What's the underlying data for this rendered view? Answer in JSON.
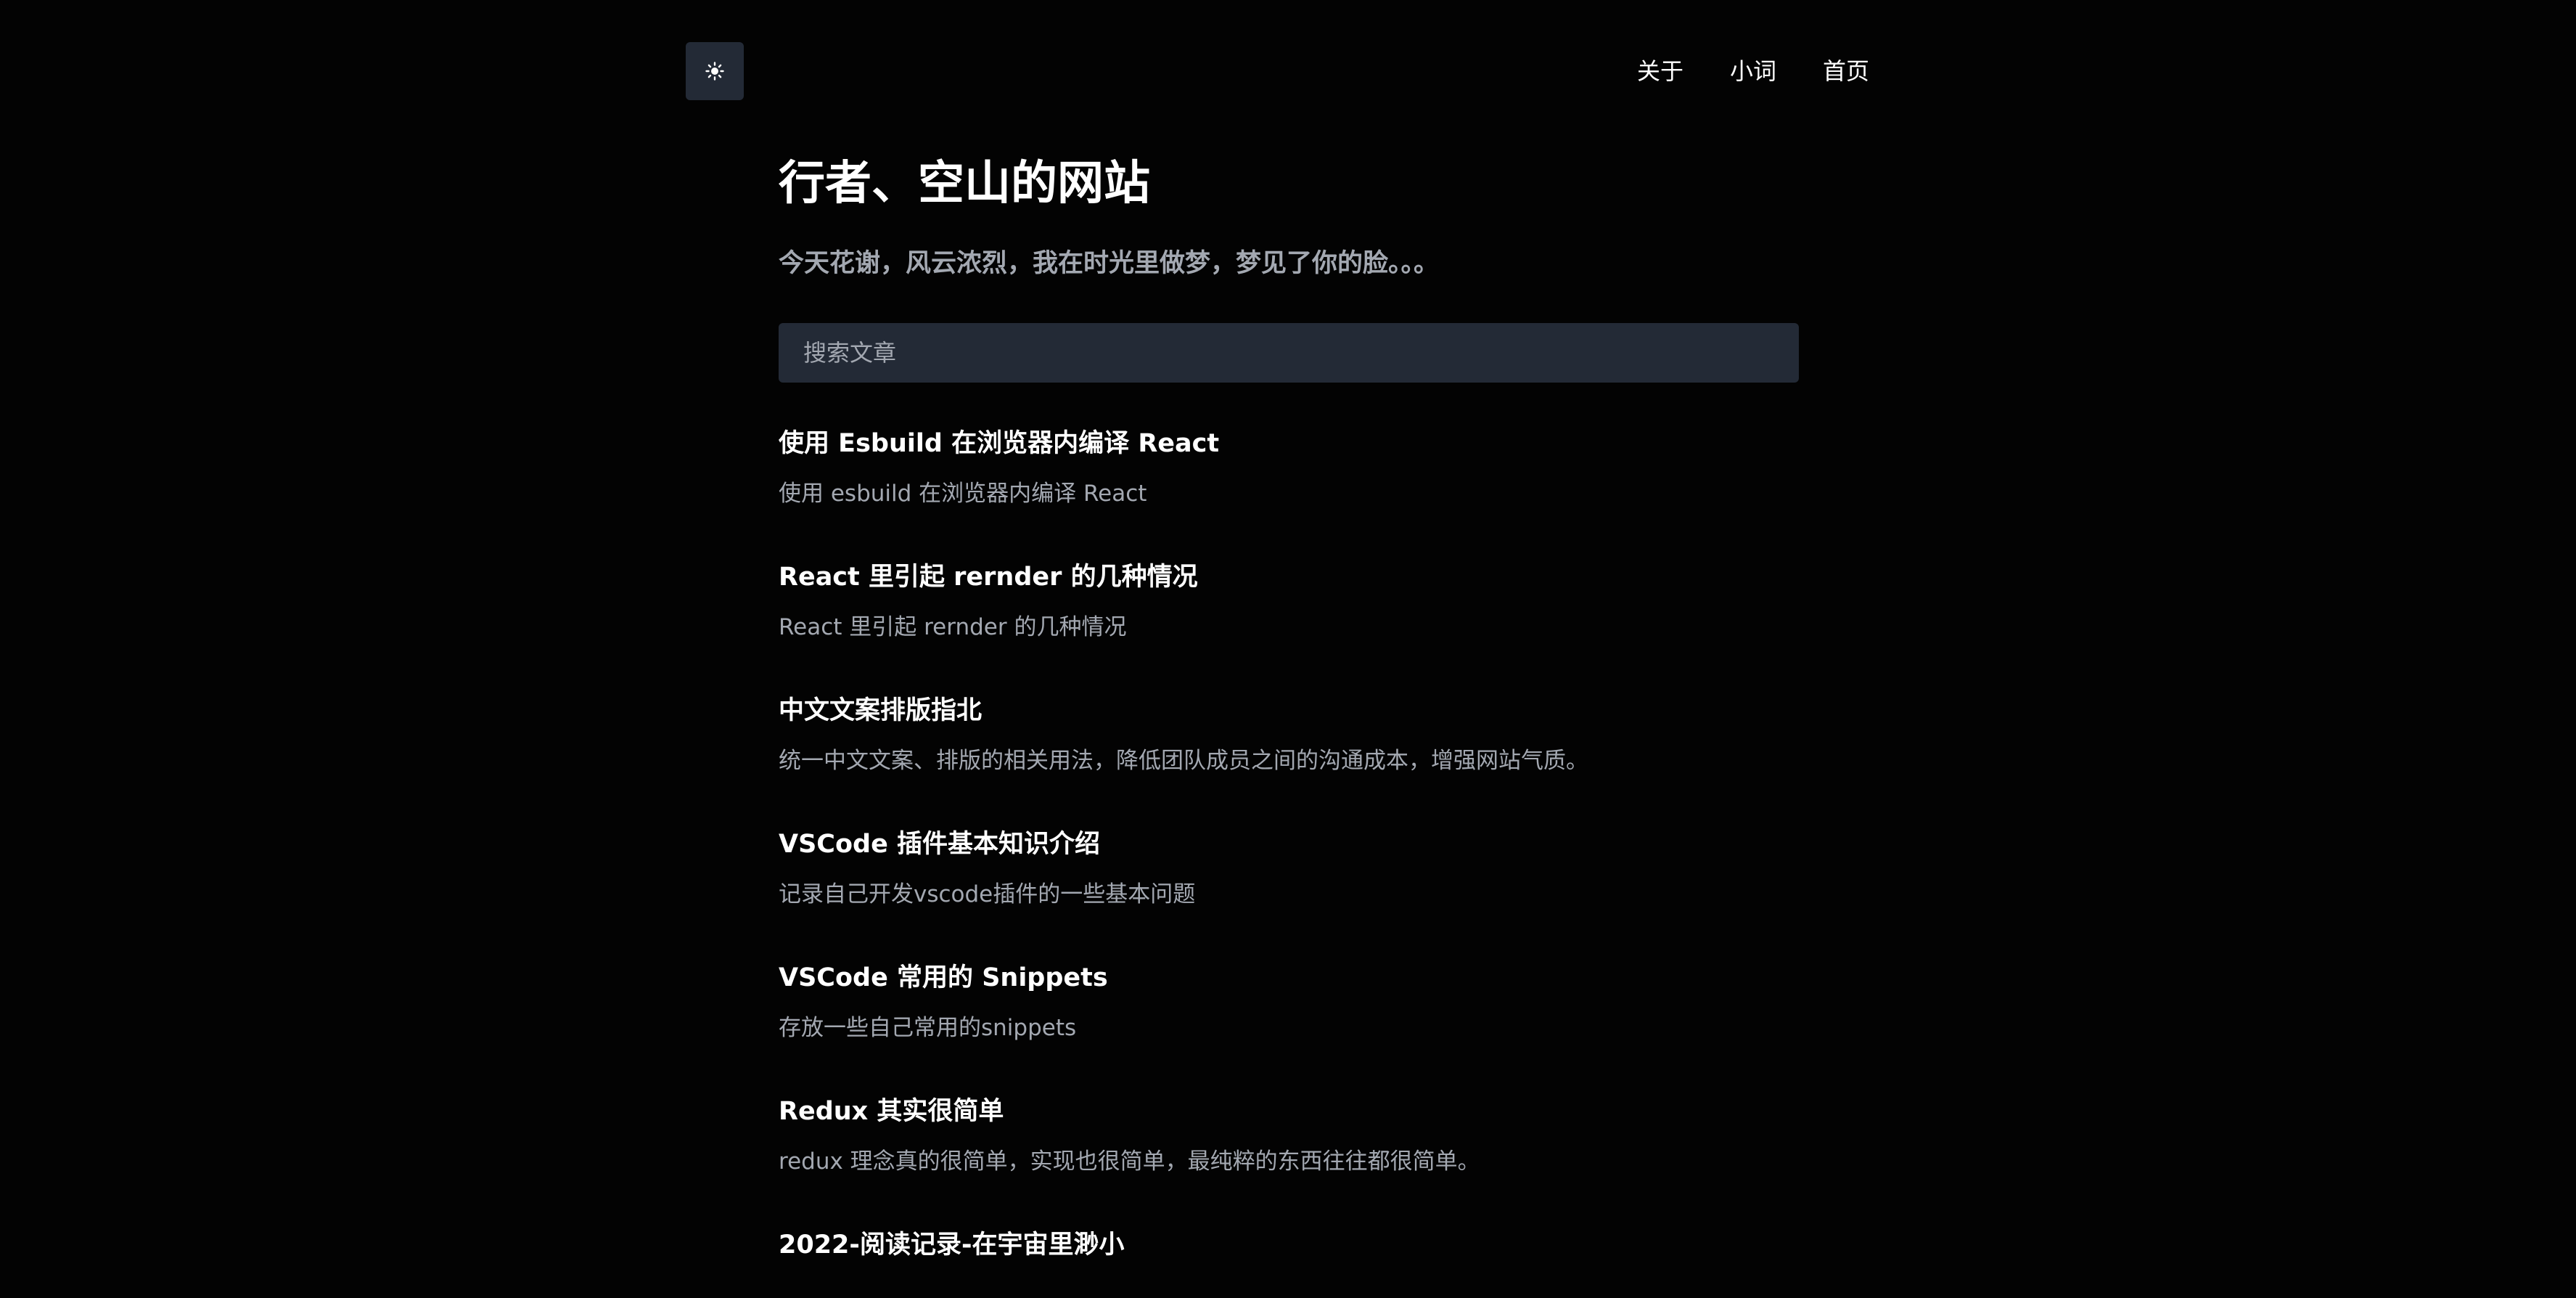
{
  "header": {
    "theme_toggle_icon": "sun-icon",
    "nav": [
      {
        "label": "关于"
      },
      {
        "label": "小词"
      },
      {
        "label": "首页"
      }
    ]
  },
  "site": {
    "title": "行者、空山的网站",
    "subtitle": "今天花谢，风云浓烈，我在时光里做梦，梦见了你的脸。。。"
  },
  "search": {
    "placeholder": "搜索文章",
    "value": ""
  },
  "articles": [
    {
      "title": "使用 Esbuild 在浏览器内编译 React",
      "description": "使用 esbuild 在浏览器内编译 React"
    },
    {
      "title": "React 里引起 rernder 的几种情况",
      "description": "React 里引起 rernder 的几种情况"
    },
    {
      "title": "中文文案排版指北",
      "description": "统一中文文案、排版的相关用法，降低团队成员之间的沟通成本，增强网站气质。"
    },
    {
      "title": "VSCode 插件基本知识介绍",
      "description": "记录自己开发vscode插件的一些基本问题"
    },
    {
      "title": "VSCode 常用的 Snippets",
      "description": "存放一些自己常用的snippets"
    },
    {
      "title": "Redux 其实很简单",
      "description": "redux 理念真的很简单，实现也很简单，最纯粹的东西往往都很简单。"
    },
    {
      "title": "2022-阅读记录-在宇宙里渺小",
      "description": ""
    }
  ]
}
